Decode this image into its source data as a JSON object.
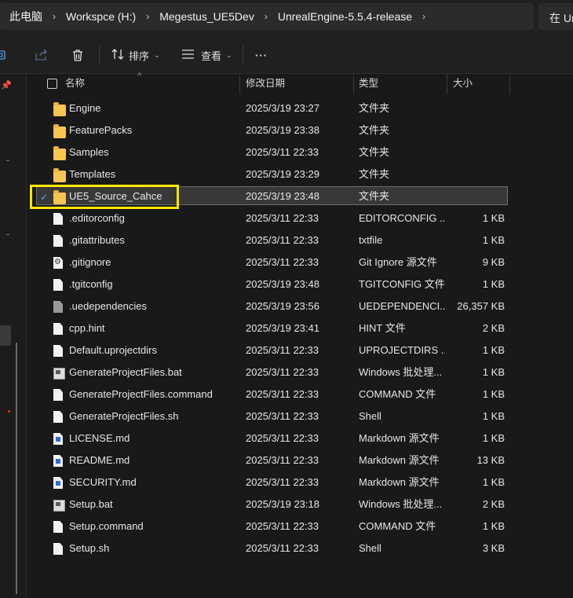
{
  "breadcrumb": {
    "items": [
      "此电脑",
      "Workspce (H:)",
      "Megestus_UE5Dev",
      "UnrealEngine-5.5.4-release"
    ],
    "separator": "›"
  },
  "search": {
    "label": "在 Ur"
  },
  "toolbar": {
    "sort_label": "排序",
    "view_label": "查看",
    "more_label": "···"
  },
  "columns": {
    "name": "名称",
    "date": "修改日期",
    "type": "类型",
    "size": "大小"
  },
  "files": [
    {
      "name": "Engine",
      "date": "2025/3/19 23:27",
      "type": "文件夹",
      "size": "",
      "icon": "folder-icon"
    },
    {
      "name": "FeaturePacks",
      "date": "2025/3/19 23:38",
      "type": "文件夹",
      "size": "",
      "icon": "folder-icon"
    },
    {
      "name": "Samples",
      "date": "2025/3/11 22:33",
      "type": "文件夹",
      "size": "",
      "icon": "folder-icon"
    },
    {
      "name": "Templates",
      "date": "2025/3/19 23:29",
      "type": "文件夹",
      "size": "",
      "icon": "folder-icon"
    },
    {
      "name": "UE5_Source_Cahce",
      "date": "2025/3/19 23:48",
      "type": "文件夹",
      "size": "",
      "icon": "folder-icon",
      "selected": true
    },
    {
      "name": ".editorconfig",
      "date": "2025/3/11 22:33",
      "type": "EDITORCONFIG ...",
      "size": "1 KB",
      "icon": "file-icon"
    },
    {
      "name": ".gitattributes",
      "date": "2025/3/11 22:33",
      "type": "txtfile",
      "size": "1 KB",
      "icon": "file-icon"
    },
    {
      "name": ".gitignore",
      "date": "2025/3/11 22:33",
      "type": "Git Ignore 源文件",
      "size": "9 KB",
      "icon": "gear-file-icon"
    },
    {
      "name": ".tgitconfig",
      "date": "2025/3/19 23:48",
      "type": "TGITCONFIG 文件",
      "size": "1 KB",
      "icon": "file-icon"
    },
    {
      "name": ".uedependencies",
      "date": "2025/3/19 23:56",
      "type": "UEDEPENDENCI...",
      "size": "26,357 KB",
      "icon": "gray-file-icon"
    },
    {
      "name": "cpp.hint",
      "date": "2025/3/19 23:41",
      "type": "HINT 文件",
      "size": "2 KB",
      "icon": "file-icon"
    },
    {
      "name": "Default.uprojectdirs",
      "date": "2025/3/11 22:33",
      "type": "UPROJECTDIRS ...",
      "size": "1 KB",
      "icon": "file-icon"
    },
    {
      "name": "GenerateProjectFiles.bat",
      "date": "2025/3/11 22:33",
      "type": "Windows 批处理...",
      "size": "1 KB",
      "icon": "batch-file-icon"
    },
    {
      "name": "GenerateProjectFiles.command",
      "date": "2025/3/11 22:33",
      "type": "COMMAND 文件",
      "size": "1 KB",
      "icon": "file-icon"
    },
    {
      "name": "GenerateProjectFiles.sh",
      "date": "2025/3/11 22:33",
      "type": "Shell",
      "size": "1 KB",
      "icon": "file-icon"
    },
    {
      "name": "LICENSE.md",
      "date": "2025/3/11 22:33",
      "type": "Markdown 源文件",
      "size": "1 KB",
      "icon": "markdown-file-icon"
    },
    {
      "name": "README.md",
      "date": "2025/3/11 22:33",
      "type": "Markdown 源文件",
      "size": "13 KB",
      "icon": "markdown-file-icon"
    },
    {
      "name": "SECURITY.md",
      "date": "2025/3/11 22:33",
      "type": "Markdown 源文件",
      "size": "1 KB",
      "icon": "markdown-file-icon"
    },
    {
      "name": "Setup.bat",
      "date": "2025/3/19 23:18",
      "type": "Windows 批处理...",
      "size": "2 KB",
      "icon": "batch-file-icon"
    },
    {
      "name": "Setup.command",
      "date": "2025/3/11 22:33",
      "type": "COMMAND 文件",
      "size": "1 KB",
      "icon": "file-icon"
    },
    {
      "name": "Setup.sh",
      "date": "2025/3/11 22:33",
      "type": "Shell",
      "size": "3 KB",
      "icon": "file-icon"
    }
  ],
  "colors": {
    "highlight": "#ffe600",
    "folder": "#f7c552",
    "selection_check": "#5fb2f2"
  }
}
